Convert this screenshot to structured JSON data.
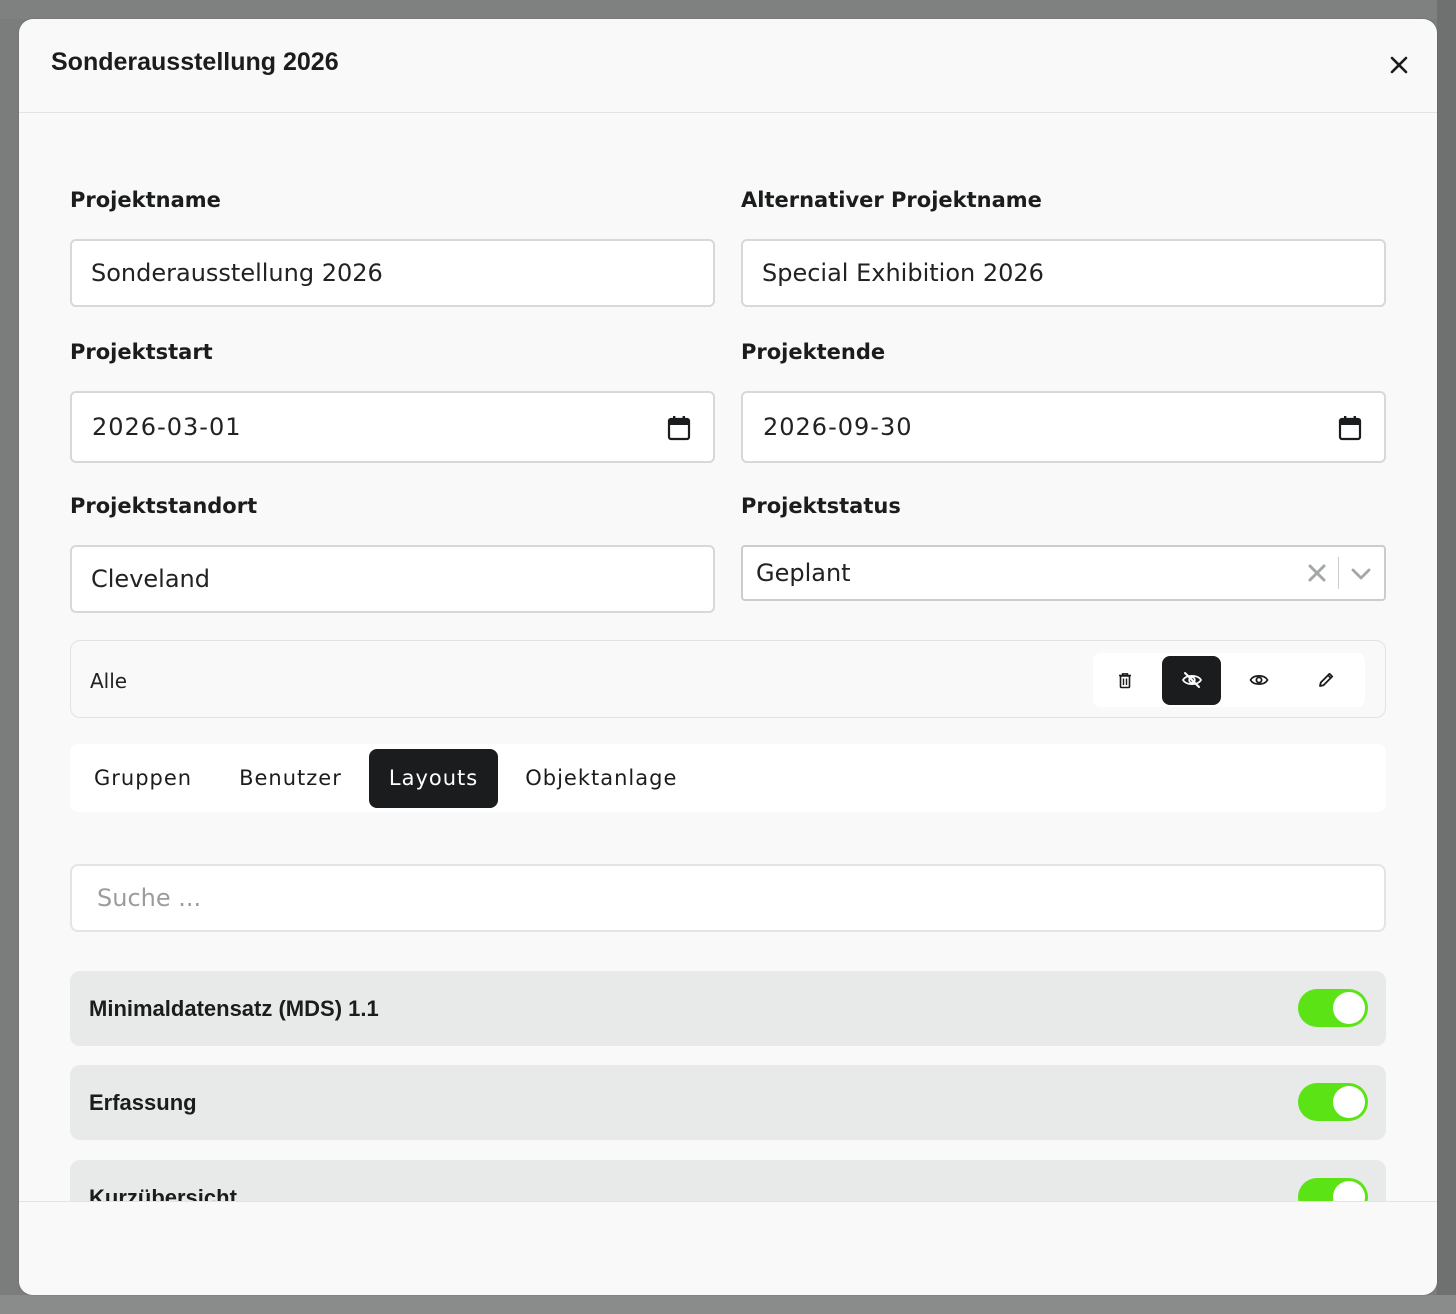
{
  "modal": {
    "title": "Sonderausstellung 2026"
  },
  "form": {
    "project_name": {
      "label": "Projektname",
      "value": "Sonderausstellung 2026"
    },
    "alt_project_name": {
      "label": "Alternativer Projektname",
      "value": "Special Exhibition 2026"
    },
    "project_start": {
      "label": "Projektstart",
      "value": "2026-03-01"
    },
    "project_end": {
      "label": "Projektende",
      "value": "2026-09-30"
    },
    "project_location": {
      "label": "Projektstandort",
      "value": "Cleveland"
    },
    "project_status": {
      "label": "Projektstatus",
      "value": "Geplant"
    }
  },
  "permissions": {
    "label": "Alle",
    "buttons": [
      "trash-icon",
      "eye-off-icon",
      "eye-icon",
      "pencil-icon"
    ],
    "active": "eye-off-icon"
  },
  "tabs": [
    {
      "label": "Gruppen",
      "active": false
    },
    {
      "label": "Benutzer",
      "active": false
    },
    {
      "label": "Layouts",
      "active": true
    },
    {
      "label": "Objektanlage",
      "active": false
    }
  ],
  "search": {
    "placeholder": "Suche ..."
  },
  "layouts": [
    {
      "name": "Minimaldatensatz (MDS) 1.1",
      "enabled": true
    },
    {
      "name": "Erfassung",
      "enabled": true
    },
    {
      "name": "Kurzübersicht",
      "enabled": true
    }
  ],
  "colors": {
    "accent_dark": "#1b1c1d",
    "toggle_on": "#5ce316",
    "row_bg": "#e8eaea",
    "modal_bg": "#f9f9f9"
  }
}
